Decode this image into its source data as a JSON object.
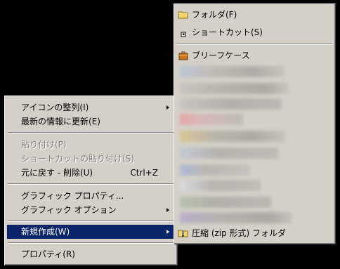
{
  "context_menu": {
    "items": [
      {
        "label": "アイコンの整列(I)"
      },
      {
        "label": "最新の情報に更新(E)"
      },
      {
        "label": "貼り付け(P)"
      },
      {
        "label": "ショートカットの貼り付け(S)"
      },
      {
        "label": "元に戻す - 削除(U)",
        "shortcut": "Ctrl+Z"
      },
      {
        "label": "グラフィック プロパティ..."
      },
      {
        "label": "グラフィック オプション"
      },
      {
        "label": "新規作成(W)"
      },
      {
        "label": "プロパティ(R)"
      }
    ]
  },
  "new_submenu": {
    "items": [
      {
        "label": "フォルダ(F)",
        "icon": "folder-icon"
      },
      {
        "label": "ショートカット(S)",
        "icon": "shortcut-icon"
      },
      {
        "label": "ブリーフケース",
        "icon": "briefcase-icon"
      },
      {
        "label": "圧縮 (zip 形式) フォルダ",
        "icon": "zip-folder-icon"
      }
    ]
  },
  "colors": {
    "menu_bg": "#d4d0c8",
    "selection": "#0a246a",
    "desktop": "#000000"
  }
}
